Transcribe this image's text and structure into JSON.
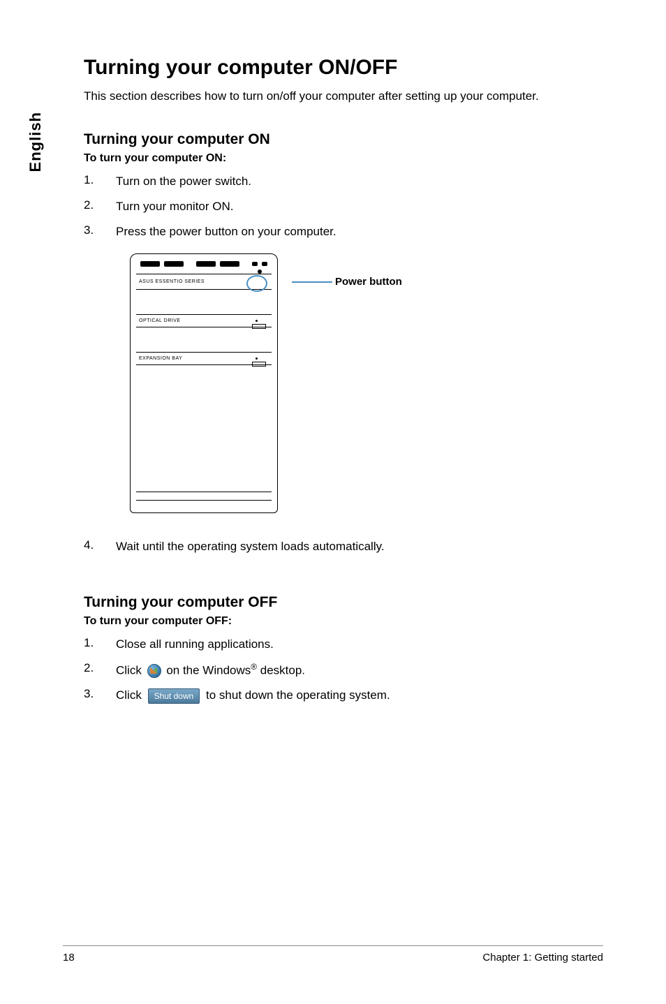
{
  "side_tab": "English",
  "h1": "Turning your computer ON/OFF",
  "intro": "This section describes how to turn on/off your computer after setting up your computer.",
  "on": {
    "heading": "Turning your computer ON",
    "sub": "To turn your computer ON:",
    "steps": [
      "Turn on the power switch.",
      "Turn your monitor ON.",
      "Press the power button on your computer."
    ],
    "step4": "Wait until the operating system loads automatically."
  },
  "figure": {
    "power_label": "Power button",
    "case_labels": {
      "top": "ASUS ESSENTIO SERIES",
      "optical": "OPTICAL DRIVE",
      "expansion": "EXPANSION BAY"
    }
  },
  "off": {
    "heading": "Turning your computer OFF",
    "sub": "To turn your computer OFF:",
    "steps": {
      "s1": "Close all running applications.",
      "s2_a": "Click",
      "s2_b": "on the Windows",
      "s2_c": "desktop.",
      "s3_a": "Click",
      "s3_b": "to shut down the operating system.",
      "shutdown_label": "Shut down"
    }
  },
  "footer": {
    "page": "18",
    "chapter": "Chapter 1: Getting started"
  }
}
